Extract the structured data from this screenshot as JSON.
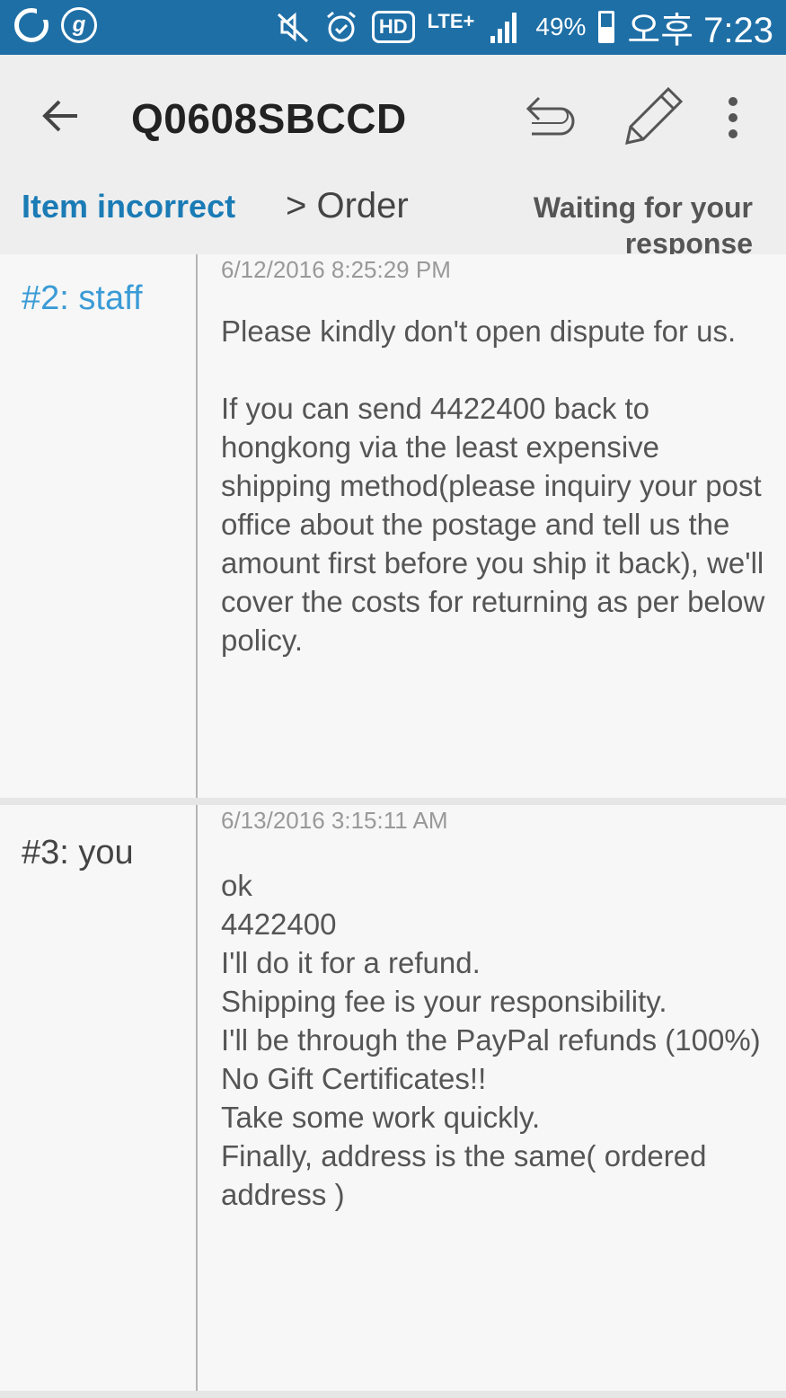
{
  "status_bar": {
    "hd": "HD",
    "network": "LTE+",
    "battery_percent": "49%",
    "time": "오후 7:23",
    "color": "#1e6fa6"
  },
  "app_bar": {
    "title": "Q0608SBCCD",
    "tab_category": "Item incorrect",
    "tab_order": "> Order",
    "status": "Waiting for your response",
    "icons": [
      "back-arrow-icon",
      "reply-icon",
      "pencil-icon",
      "more-vert-icon"
    ],
    "accent_color": "#1a7bb5"
  },
  "messages": [
    {
      "author": "#2: staff",
      "timestamp": "6/12/2016 8:25:29 PM",
      "body": "Please kindly don't open dispute for us.\n\nIf you can send 4422400 back to hongkong via the least expensive shipping method(please inquiry your post office about the postage and tell us the amount first before you ship it back), we'll cover the costs for returning as per below policy."
    },
    {
      "author": "#3: you",
      "timestamp": "6/13/2016 3:15:11 AM",
      "body": "ok\n4422400\nI'll do it for a refund.\nShipping fee is your responsibility.\nI'll be through the PayPal refunds (100%)\nNo Gift Certificates!!\nTake some work quickly.\nFinally, address is the same( ordered address )"
    }
  ]
}
